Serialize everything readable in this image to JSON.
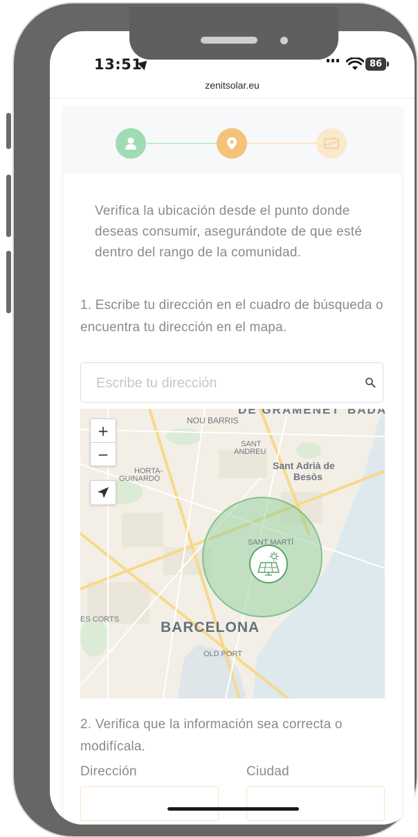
{
  "status_bar": {
    "time": "13:51",
    "battery": "86"
  },
  "browser": {
    "url": "zenitsolar.eu"
  },
  "stepper": {
    "steps": [
      "user-icon",
      "location-pin-icon",
      "card-icon"
    ],
    "colors": {
      "done": "#9fdcb3",
      "active": "#f5c27a",
      "pending": "#fbe9cc"
    }
  },
  "main": {
    "intro": "Verifica la ubicación desde el punto donde deseas consumir, asegurándote de que esté dentro del rango de la comunidad.",
    "step1_text": "1. Escribe tu dirección en el cuadro de búsqueda o encuentra tu dirección en el mapa.",
    "search": {
      "placeholder": "Escribe tu dirección",
      "value": ""
    },
    "step2_text": "2. Verifica que la información sea correcta o modifícala.",
    "fields": {
      "address_label": "Dirección",
      "city_label": "Ciudad",
      "address_value": "",
      "city_value": ""
    }
  },
  "map": {
    "zoom_in": "+",
    "zoom_out": "−",
    "labels": {
      "top_left_district": "DE GRAMENET",
      "top_right": "BADA",
      "nou_barris": "NOU BARRIS",
      "sant_andreu_1": "SANT",
      "sant_andreu_2": "ANDREU",
      "sant_adria_1": "Sant Adrià de",
      "sant_adria_2": "Besòs",
      "horta_1": "HORTA-",
      "horta_2": "GUINARDÓ",
      "sant_marti": "SANT MARTÍ",
      "les_corts": "ES CORTS",
      "barcelona": "BARCELONA",
      "old_port": "OLD PORT"
    },
    "colors": {
      "land": "#f3efe6",
      "sea": "#dde9ec",
      "coverage": "#89cd96"
    }
  }
}
